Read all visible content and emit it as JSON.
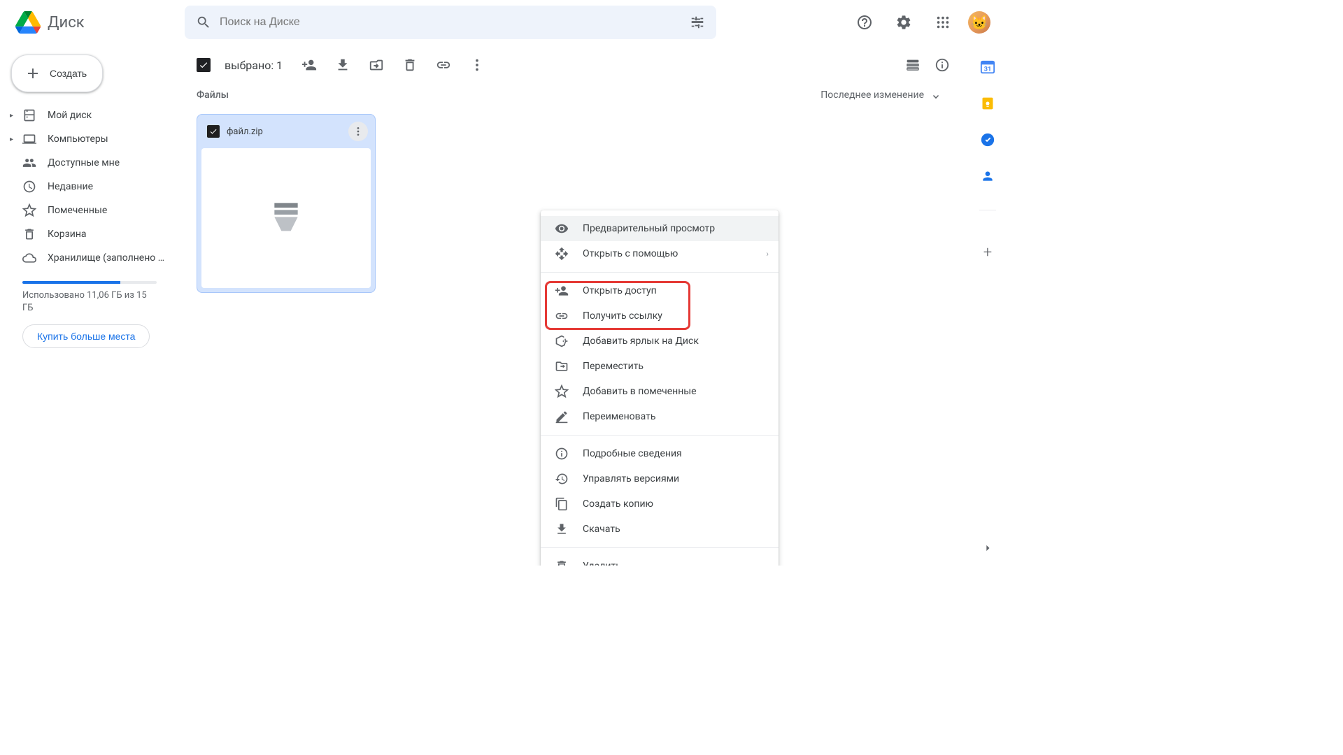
{
  "app_name": "Диск",
  "search": {
    "placeholder": "Поиск на Диске"
  },
  "create_button": "Создать",
  "nav": {
    "my_drive": "Мой диск",
    "computers": "Компьютеры",
    "shared": "Доступные мне",
    "recent": "Недавние",
    "starred": "Помеченные",
    "trash": "Корзина",
    "storage": "Хранилище (заполнено ..."
  },
  "storage": {
    "used_text": "Использовано 11,06 ГБ из 15 ГБ",
    "buy_button": "Купить больше места",
    "fill_percent": 73
  },
  "selection": {
    "label": "выбрано: 1"
  },
  "content": {
    "files_heading": "Файлы",
    "sort_label": "Последнее изменение"
  },
  "file": {
    "name": "файл.zip"
  },
  "menu": {
    "preview": "Предварительный просмотр",
    "open_with": "Открыть с помощью",
    "share": "Открыть доступ",
    "get_link": "Получить ссылку",
    "add_shortcut": "Добавить ярлык на Диск",
    "move": "Переместить",
    "add_starred": "Добавить в помеченные",
    "rename": "Переименовать",
    "details": "Подробные сведения",
    "manage_versions": "Управлять версиями",
    "make_copy": "Создать копию",
    "download": "Скачать",
    "delete": "Удалить"
  },
  "colors": {
    "accent": "#1a73e8",
    "highlight": "#e53935"
  }
}
